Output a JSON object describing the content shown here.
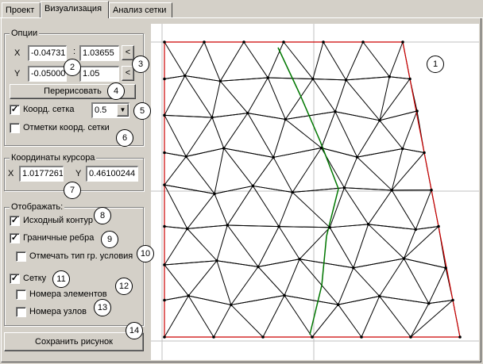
{
  "tabs": [
    "Проект",
    "Визуализация",
    "Анализ сетки"
  ],
  "options": {
    "title": "Опции",
    "x_label": "X",
    "y_label": "Y",
    "sep": ":",
    "x_min": "-0.04731",
    "x_max": "1.03655",
    "y_min": "-0.050000",
    "y_max": "1.05",
    "x_arrow": "<",
    "y_arrow": "<",
    "redraw_label": "Перерисовать",
    "coord_grid_label": "Коорд. сетка",
    "coord_grid_checked": true,
    "coord_grid_value": "0.5",
    "coord_marks_label": "Отметки коорд. сетки",
    "coord_marks_checked": false
  },
  "cursor": {
    "title": "Координаты курсора",
    "x_label": "X",
    "y_label": "Y",
    "x_value": "1.0177261",
    "y_value": "0.46100244"
  },
  "display": {
    "title": "Отображать:",
    "source_contour": "Исходный контур",
    "boundary_edges": "Граничные ребра",
    "mark_bc": "Отмечать тип гр. условия",
    "grid": "Сетку",
    "element_numbers": "Номера элементов",
    "node_numbers": "Номера узлов"
  },
  "save_label": "Сохранить рисунок",
  "callouts": [
    "1",
    "2",
    "3",
    "4",
    "5",
    "6",
    "7",
    "8",
    "9",
    "10",
    "11",
    "12",
    "13",
    "14"
  ],
  "check_glyph": "✓",
  "dropdown_arrow": "▼",
  "colors": {
    "mesh": "#000000",
    "boundary": "#cc0000",
    "highlight": "#007700",
    "axis": "#c0c0c0"
  }
}
